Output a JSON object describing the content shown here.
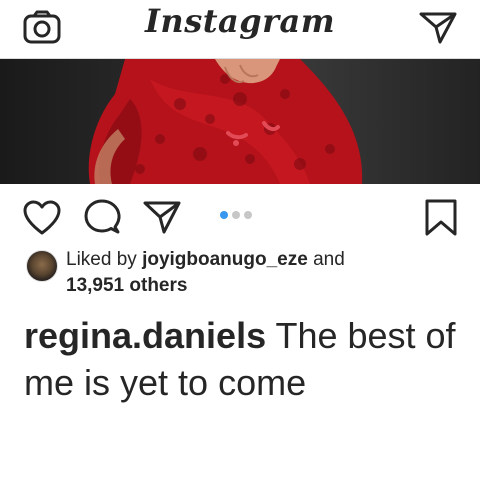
{
  "app": {
    "title": "Instagram"
  },
  "colors": {
    "accent": "#3897f0",
    "text": "#262626",
    "divider": "#dbdbdb"
  },
  "header": {
    "left_icon": "camera-icon",
    "right_icon": "direct-message-icon"
  },
  "post": {
    "carousel": {
      "total": 3,
      "active_index": 0
    },
    "actions": {
      "icons": [
        "heart-icon",
        "comment-icon",
        "share-icon",
        "bookmark-icon"
      ]
    },
    "likes": {
      "prefix": "Liked by",
      "user": "joyigboanugo_eze",
      "conjunction": "and",
      "others": "13,951 others"
    },
    "caption": {
      "username": "regina.daniels",
      "text": "The best of me is yet to come"
    }
  }
}
